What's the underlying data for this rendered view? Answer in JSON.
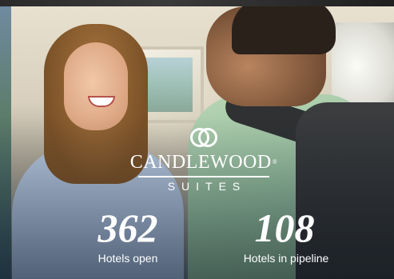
{
  "brand": {
    "name": "CANDLEWOOD",
    "registered_mark": "®",
    "subtitle": "SUITES",
    "logo_icon": "candlewood-interlocking-rings-icon"
  },
  "stats": [
    {
      "value": "362",
      "label": "Hotels open"
    },
    {
      "value": "108",
      "label": "Hotels in pipeline"
    }
  ],
  "photo": {
    "icon": "hotel-front-desk-photo"
  },
  "colors": {
    "text": "#ffffff",
    "shirt_staff": "#9fb3d0",
    "shirt_guest": "#8fb89a",
    "wall": "#e8e1cf"
  }
}
